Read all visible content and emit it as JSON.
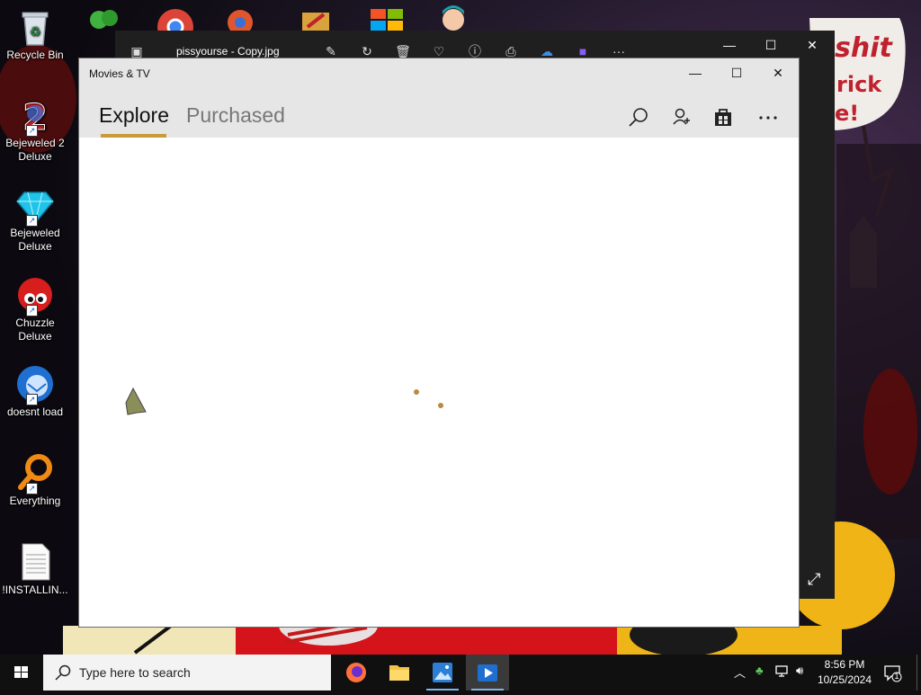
{
  "desktop": {
    "icons": [
      {
        "label": "Recycle Bin"
      },
      {
        "label": "Bejeweled 2\nDeluxe"
      },
      {
        "label": "Bejeweled\nDeluxe"
      },
      {
        "label": "Chuzzle\nDeluxe"
      },
      {
        "label": "doesnt load"
      },
      {
        "label": "Everything"
      },
      {
        "label": "!INSTALLIN..."
      }
    ],
    "wallpaper_text": {
      "line1": "shit",
      "line2": "rick",
      "line3": "e!"
    }
  },
  "photos_window": {
    "title": "pissyourse - Copy.jpg",
    "icons": [
      "image-icon",
      "edit-icon",
      "rotate-icon",
      "delete-icon",
      "heart-icon",
      "info-icon",
      "print-icon",
      "onedrive-icon",
      "clipchamp-icon",
      "more-icon"
    ]
  },
  "movies_window": {
    "title": "Movies & TV",
    "tabs": [
      {
        "label": "Explore",
        "selected": true
      },
      {
        "label": "Purchased",
        "selected": false
      }
    ],
    "header_icons": [
      "search-icon",
      "account-icon",
      "store-icon",
      "more-icon"
    ],
    "accent_color": "#c79b3a"
  },
  "taskbar": {
    "search_placeholder": "Type here to search",
    "apps": [
      "firefox-icon",
      "file-explorer-icon",
      "photos-icon",
      "movies-tv-icon"
    ],
    "active_app": "movies-tv-icon",
    "time": "8:56 PM",
    "date": "10/25/2024",
    "notification_count": "1"
  }
}
